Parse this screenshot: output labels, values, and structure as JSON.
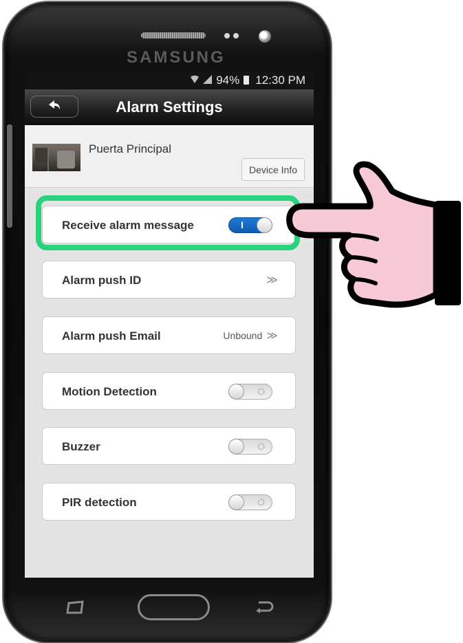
{
  "device_brand": "SAMSUNG",
  "status_bar": {
    "battery": "94%",
    "time": "12:30 PM"
  },
  "header": {
    "title": "Alarm Settings"
  },
  "device": {
    "name": "Puerta Principal",
    "info_button": "Device Info"
  },
  "settings": [
    {
      "label": "Receive alarm message",
      "control": "toggle",
      "value": true
    },
    {
      "label": "Alarm push ID",
      "control": "link"
    },
    {
      "label": "Alarm push Email",
      "control": "link",
      "value_text": "Unbound"
    },
    {
      "label": "Motion Detection",
      "control": "toggle",
      "value": false
    },
    {
      "label": "Buzzer",
      "control": "toggle",
      "value": false
    },
    {
      "label": "PIR detection",
      "control": "toggle",
      "value": false
    }
  ],
  "toggle_marks": {
    "on": "I",
    "off": "O"
  },
  "chevron": "≫",
  "icons": {
    "back": "back-arrow-icon",
    "wifi": "wifi-icon",
    "signal": "cellular-signal-icon",
    "battery": "battery-icon",
    "recent": "recent-apps-icon",
    "back_nav": "back-nav-icon",
    "pointer": "pointing-hand-icon"
  },
  "colors": {
    "highlight": "#2bd27d",
    "toggle_on": "#1f7ad8",
    "titlebar": "#1a1a1a",
    "hand_fill": "#f7cad6"
  }
}
